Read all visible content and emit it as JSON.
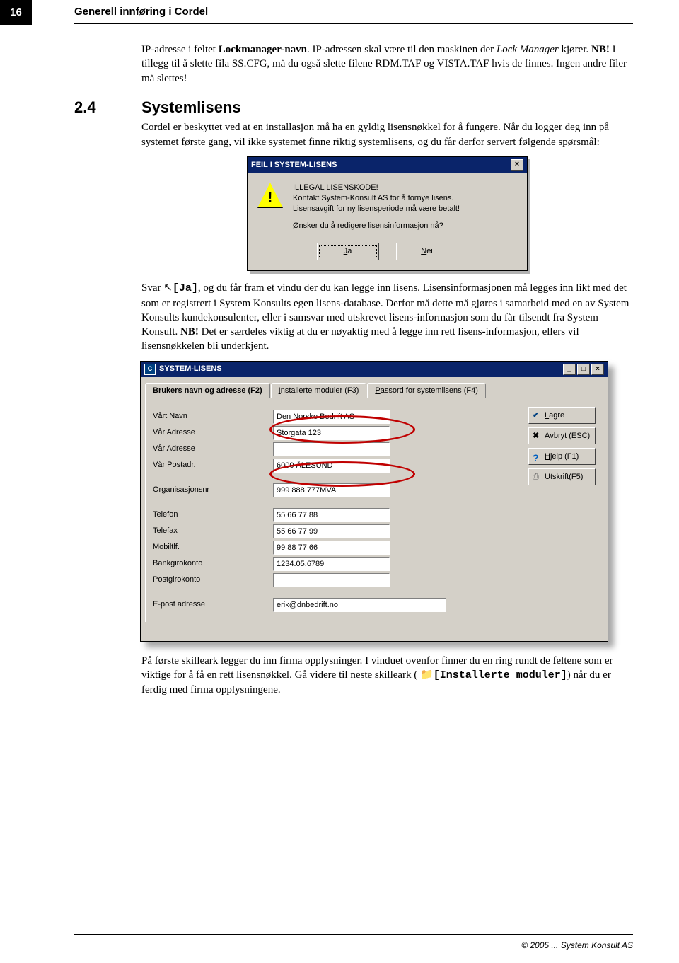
{
  "page_number": "16",
  "chapter_title": "Generell innføring i Cordel",
  "intro": {
    "p1a": "IP-adresse i feltet ",
    "p1b": "Lockmanager-navn",
    "p1c": ".  IP-adressen skal være til den maskinen der ",
    "p1d": "Lock Manager",
    "p1e": " kjører.  ",
    "p1nb": "NB!",
    "p1f": "  I tillegg til å slette fila SS.CFG, må du også slette filene RDM.TAF og VISTA.TAF hvis de finnes. Ingen andre filer må slettes!"
  },
  "section": {
    "number": "2.4",
    "title": "Systemlisens",
    "p2": "Cordel er beskyttet ved at en installasjon må ha en gyldig lisensnøkkel for å fungere.  Når du logger deg inn på systemet første gang, vil ikke systemet finne riktig systemlisens, og du får derfor servert følgende spørsmål:"
  },
  "dialog1": {
    "title": "FEIL I SYSTEM-LISENS",
    "line1": "ILLEGAL LISENSKODE!",
    "line2": "Kontakt System-Konsult AS for å fornye lisens.",
    "line3": "Lisensavgift for ny lisensperiode må være betalt!",
    "line4": "Ønsker du å redigere lisensinformasjon nå?",
    "btn_yes_u": "J",
    "btn_yes_rest": "a",
    "btn_no_u": "N",
    "btn_no_rest": "ei",
    "close": "×"
  },
  "mid": {
    "p3a": "Svar ",
    "p3cursor": "↖",
    "p3ja": "[Ja]",
    "p3b": ", og du får fram et vindu der du kan legge inn lisens. Lisensinformasjonen må legges inn likt med det som er registrert i System Konsults egen lisens-database.  Derfor må dette må gjøres i samarbeid med en av System Konsults kundekonsulenter, eller i samsvar med utskrevet lisens-informasjon som du får tilsendt fra System Konsult.  ",
    "p3nb": "NB!",
    "p3c": " Det er særdeles viktig at du er nøyaktig med å legge inn rett lisens-informasjon, ellers vil lisensnøkkelen bli underkjent."
  },
  "dialog2": {
    "title": "SYSTEM-LISENS",
    "logo": "C",
    "win_min": "_",
    "win_max": "□",
    "win_close": "×",
    "tab1": "Brukers navn og adresse (F2)",
    "tab2_u": "I",
    "tab2_rest": "nstallerte moduler (F3)",
    "tab3_u": "P",
    "tab3_rest": "assord for systemlisens (F4)",
    "btn_lagre": "Lagre",
    "btn_lagre_u": "L",
    "btn_avbryt": "Avbryt (ESC)",
    "btn_avbryt_u": "A",
    "btn_hjelp": "jelp (F1)",
    "btn_hjelp_u": "H",
    "btn_utskrift": "tskrift(F5)",
    "btn_utskrift_u": "U",
    "labels": {
      "navn": "Vårt Navn",
      "adr1": "Vår  Adresse",
      "adr2": "Vår  Adresse",
      "post": "Vår  Postadr.",
      "orgnr": "Organisasjonsnr",
      "tlf": "Telefon",
      "fax": "Telefax",
      "mob": "Mobiltlf.",
      "bank": "Bankgirokonto",
      "postgiro": "Postgirokonto",
      "epost": "E-post adresse"
    },
    "values": {
      "navn": "Den Norske Bedrift AS",
      "adr1": "Storgata 123",
      "adr2": "",
      "post": "6000 ÅLESUND",
      "orgnr": "999 888 777MVA",
      "tlf": "55 66 77 88",
      "fax": "55 66 77 99",
      "mob": "99 88 77 66",
      "bank": "1234.05.6789",
      "postgiro": "",
      "epost": "erik@dnbedrift.no"
    }
  },
  "outro": {
    "p4a": "På første skilleark legger du inn firma opplysninger.  I vinduet ovenfor finner du en ring rundt de feltene som er viktige for å få en rett lisensnøkkel.  Gå videre til neste skilleark (",
    "p4icon": "📁",
    "p4b": "[Installerte moduler]",
    "p4c": ") når du er ferdig med firma opplysningene."
  },
  "footer": "© 2005 ... System Konsult AS"
}
